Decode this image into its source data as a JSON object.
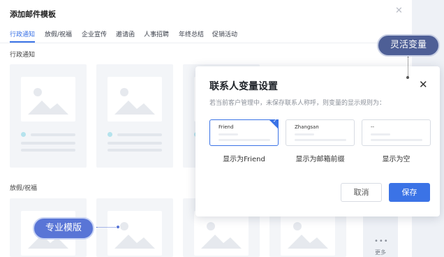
{
  "panel": {
    "title": "添加邮件模板",
    "close_icon": "close-icon",
    "tabs": [
      "行政通知",
      "放假/祝福",
      "企业宣传",
      "邀请函",
      "人事招聘",
      "年终总结",
      "促销活动"
    ],
    "active_tab": "行政通知",
    "sections": [
      "行政通知",
      "放假/祝福"
    ],
    "more_label": "更多",
    "more_icon": "more-dots-icon"
  },
  "dialog": {
    "title": "联系人变量设置",
    "description": "若当前客户管理中，未保存联系人称呼，则变量的显示规则为：",
    "options": [
      {
        "sample": "Friend",
        "caption": "显示为Friend",
        "selected": true
      },
      {
        "sample": "Zhangsan",
        "caption": "显示为邮箱前缀",
        "selected": false
      },
      {
        "sample": "--",
        "caption": "显示为空",
        "selected": false
      }
    ],
    "cancel_label": "取消",
    "save_label": "保存"
  },
  "callouts": {
    "variable": "灵活变量",
    "pro_template": "专业模版"
  },
  "colors": {
    "accent": "#3b73e6",
    "callout_dark": "#4e5f96",
    "callout_blue": "#5975d6"
  }
}
